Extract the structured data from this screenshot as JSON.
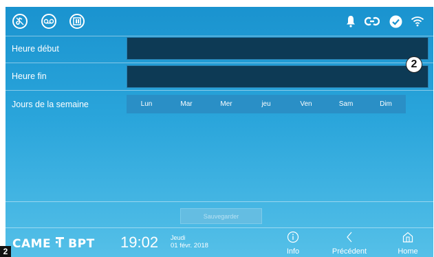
{
  "topbar": {
    "left_icons": [
      "mute-ringtone-icon",
      "answering-machine-icon",
      "door-status-icon"
    ],
    "status_icons": [
      "bell-icon",
      "link-icon",
      "check-icon",
      "wifi-icon"
    ]
  },
  "form": {
    "start_label": "Heure début",
    "start_value": "",
    "end_label": "Heure fin",
    "end_value": "",
    "days_label": "Jours de la semaine",
    "days": [
      "Lun",
      "Mar",
      "Mer",
      "jeu",
      "Ven",
      "Sam",
      "Dim"
    ]
  },
  "save_label": "Sauvegarder",
  "footer": {
    "brand_left": "CAME",
    "brand_right": "BPT",
    "time": "19:02",
    "weekday": "Jeudi",
    "date": "01 févr. 2018",
    "info_label": "Info",
    "back_label": "Précédent",
    "home_label": "Home"
  },
  "callout_number": "2",
  "corner_number": "2",
  "colors": {
    "background_top": "#1a93cf",
    "background_bottom": "#55c0e8",
    "field_fill": "#0d3a55",
    "day_button": "#2a8fc6"
  }
}
